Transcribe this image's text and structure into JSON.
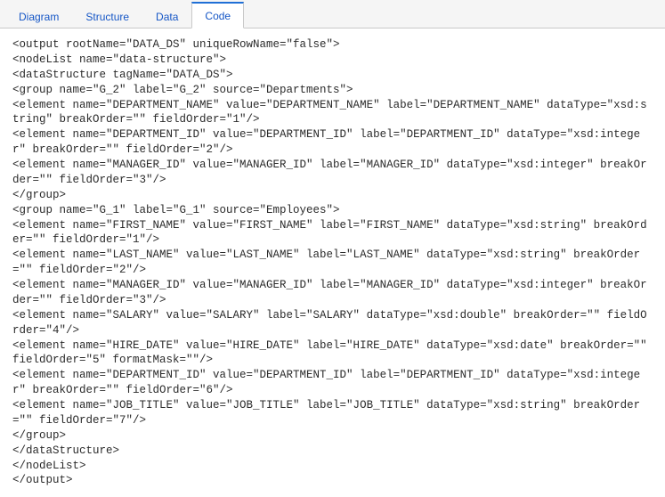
{
  "tabs": {
    "diagram": "Diagram",
    "structure": "Structure",
    "data": "Data",
    "code": "Code"
  },
  "code": "<output rootName=\"DATA_DS\" uniqueRowName=\"false\">\n<nodeList name=\"data-structure\">\n<dataStructure tagName=\"DATA_DS\">\n<group name=\"G_2\" label=\"G_2\" source=\"Departments\">\n<element name=\"DEPARTMENT_NAME\" value=\"DEPARTMENT_NAME\" label=\"DEPARTMENT_NAME\" dataType=\"xsd:string\" breakOrder=\"\" fieldOrder=\"1\"/>\n<element name=\"DEPARTMENT_ID\" value=\"DEPARTMENT_ID\" label=\"DEPARTMENT_ID\" dataType=\"xsd:integer\" breakOrder=\"\" fieldOrder=\"2\"/>\n<element name=\"MANAGER_ID\" value=\"MANAGER_ID\" label=\"MANAGER_ID\" dataType=\"xsd:integer\" breakOrder=\"\" fieldOrder=\"3\"/>\n</group>\n<group name=\"G_1\" label=\"G_1\" source=\"Employees\">\n<element name=\"FIRST_NAME\" value=\"FIRST_NAME\" label=\"FIRST_NAME\" dataType=\"xsd:string\" breakOrder=\"\" fieldOrder=\"1\"/>\n<element name=\"LAST_NAME\" value=\"LAST_NAME\" label=\"LAST_NAME\" dataType=\"xsd:string\" breakOrder=\"\" fieldOrder=\"2\"/>\n<element name=\"MANAGER_ID\" value=\"MANAGER_ID\" label=\"MANAGER_ID\" dataType=\"xsd:integer\" breakOrder=\"\" fieldOrder=\"3\"/>\n<element name=\"SALARY\" value=\"SALARY\" label=\"SALARY\" dataType=\"xsd:double\" breakOrder=\"\" fieldOrder=\"4\"/>\n<element name=\"HIRE_DATE\" value=\"HIRE_DATE\" label=\"HIRE_DATE\" dataType=\"xsd:date\" breakOrder=\"\" fieldOrder=\"5\" formatMask=\"\"/>\n<element name=\"DEPARTMENT_ID\" value=\"DEPARTMENT_ID\" label=\"DEPARTMENT_ID\" dataType=\"xsd:integer\" breakOrder=\"\" fieldOrder=\"6\"/>\n<element name=\"JOB_TITLE\" value=\"JOB_TITLE\" label=\"JOB_TITLE\" dataType=\"xsd:string\" breakOrder=\"\" fieldOrder=\"7\"/>\n</group>\n</dataStructure>\n</nodeList>\n</output>"
}
